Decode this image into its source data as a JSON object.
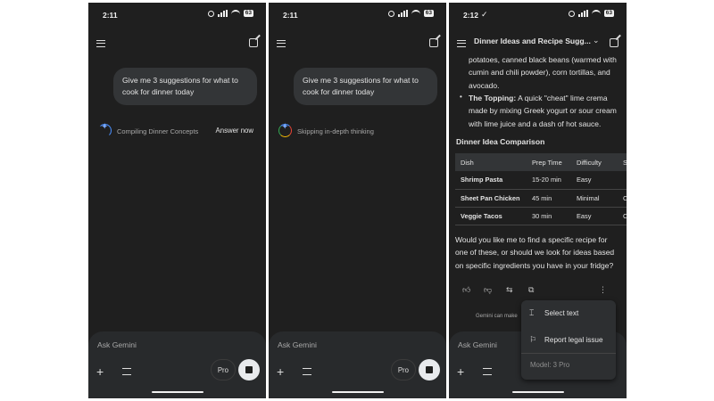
{
  "status": {
    "time1": "2:11",
    "time2": "2:11",
    "time3": "2:12",
    "check": "✓",
    "battery": "63"
  },
  "prompt": "Give me 3 suggestions for what to cook for dinner today",
  "screen1": {
    "thinking": "Compiling Dinner Concepts",
    "answer_now": "Answer now"
  },
  "screen2": {
    "thinking": "Skipping in-depth thinking"
  },
  "composer": {
    "placeholder": "Ask Gemini",
    "pro": "Pro"
  },
  "screen3": {
    "title": "Dinner Ideas and Recipe Sugg...",
    "top_lines": [
      "potatoes, canned black beans (warmed with",
      "cumin and chili powder), corn tortillas, and",
      "avocado."
    ],
    "bullet_bold": "The Topping:",
    "bullet_lines": [
      " A quick \"cheat\" lime crema",
      "made by mixing Greek yogurt or sour cream",
      "with lime juice and a dash of hot sauce."
    ],
    "section": "Dinner Idea Comparison",
    "table": {
      "headers": [
        "Dish",
        "Prep Time",
        "Difficulty",
        "S"
      ],
      "rows": [
        [
          "Shrimp Pasta",
          "15-20 min",
          "Easy",
          ""
        ],
        [
          "Sheet Pan Chicken",
          "45 min",
          "Minimal",
          "C"
        ],
        [
          "Veggie Tacos",
          "30 min",
          "Easy",
          "C"
        ]
      ]
    },
    "closing": [
      "Would you like me to find a specific recipe for",
      "one of these, or should we look for ideas based",
      "on specific ingredients you have in your fridge?"
    ],
    "disclaimer": "Gemini can make",
    "menu": {
      "select_text": "Select text",
      "report": "Report legal issue",
      "model": "Model: 3 Pro"
    }
  }
}
